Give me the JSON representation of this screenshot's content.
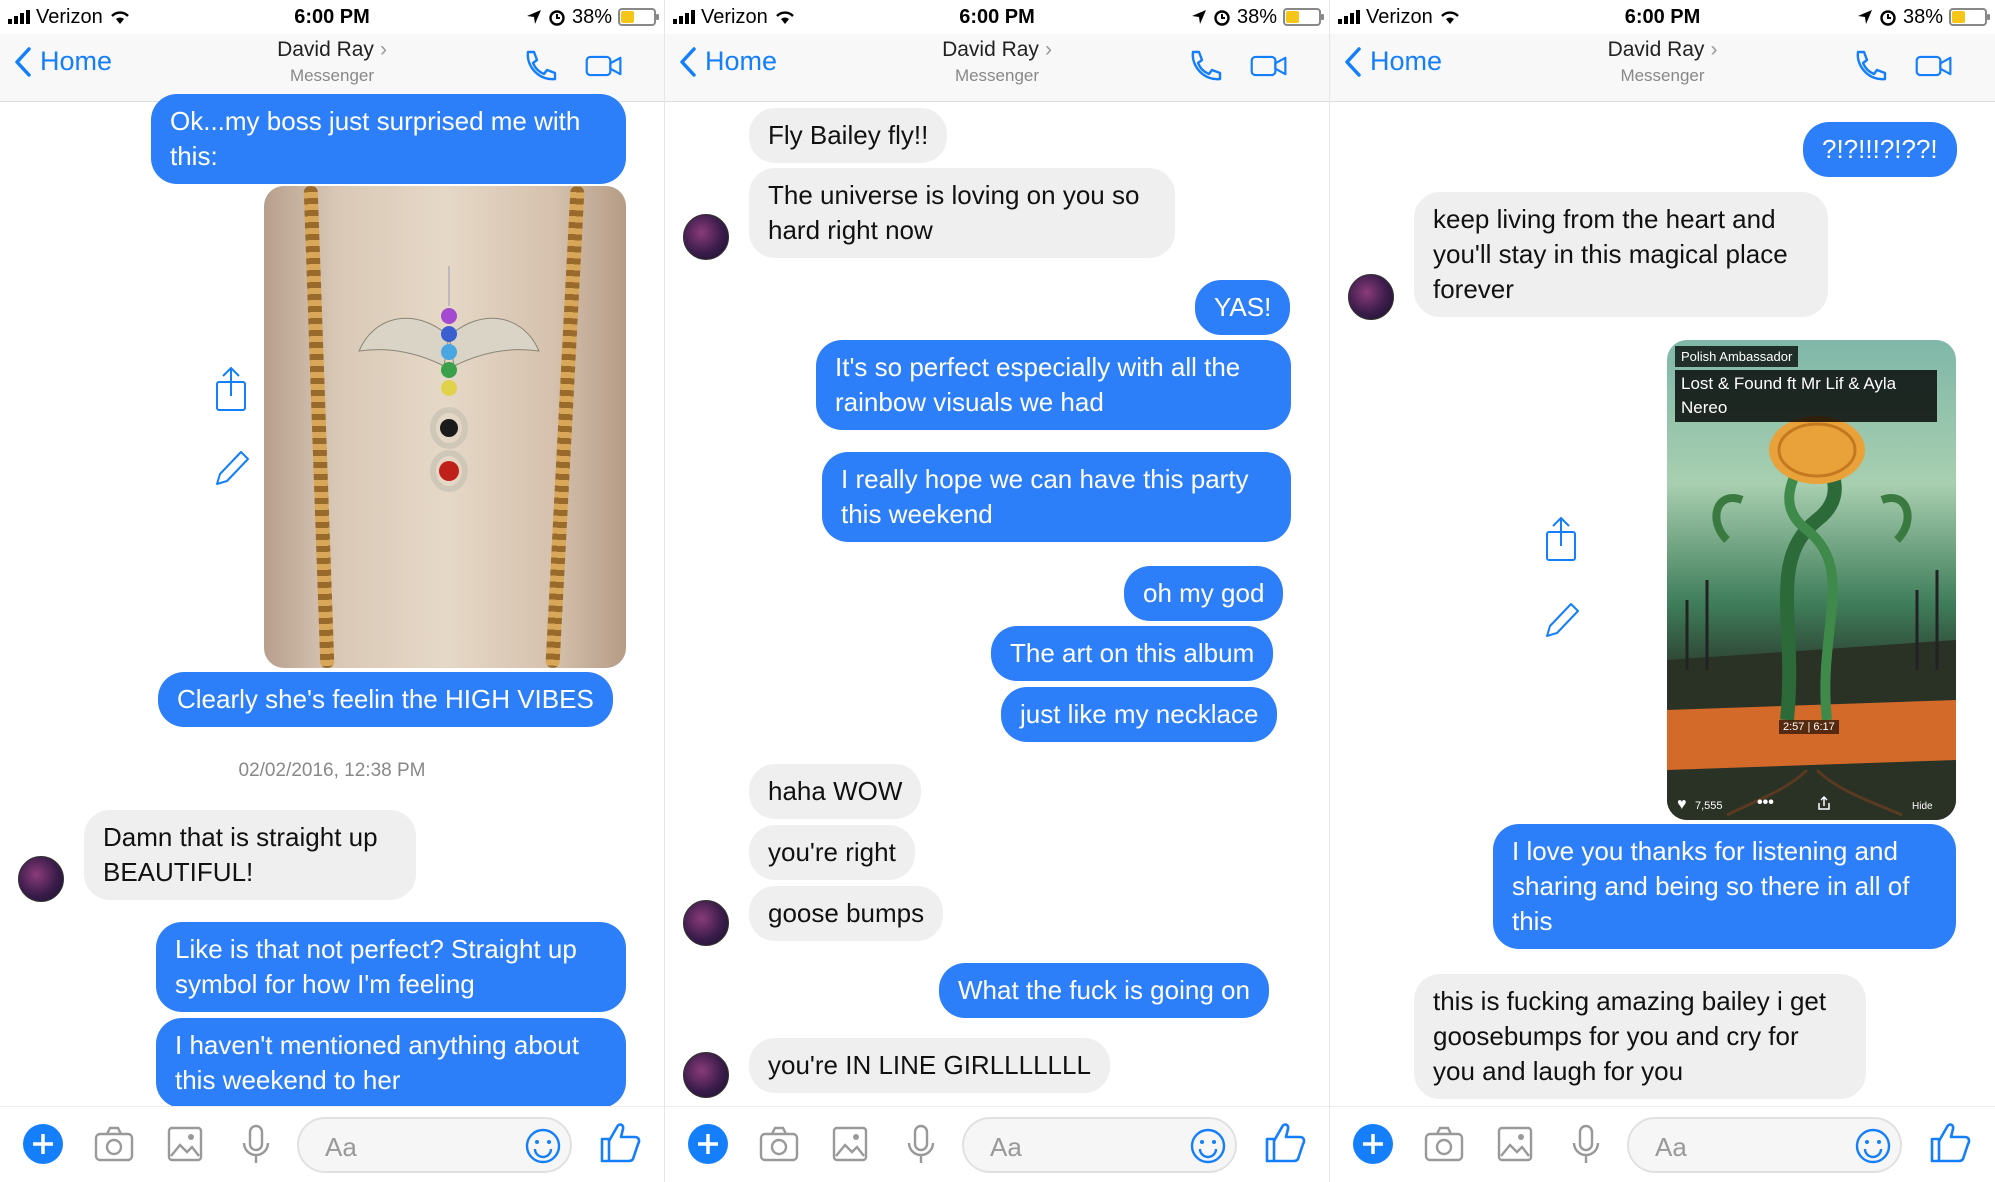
{
  "colors": {
    "accent": "#2d7ff9",
    "incoming": "#efefef",
    "nav_blue": "#147efb"
  },
  "status": {
    "carrier": "Verizon",
    "time": "6:00 PM",
    "battery": "38%",
    "battery_level": 0.38
  },
  "nav": {
    "back": "Home",
    "name": "David Ray",
    "sub": "Messenger"
  },
  "composer": {
    "placeholder": "Aa"
  },
  "screens": [
    {
      "messages": [
        {
          "text": "Ok...my boss just surprised me with this:"
        },
        {
          "text": "Clearly she's feelin the HIGH VIBES"
        },
        {
          "text": "02/02/2016, 12:38 PM"
        },
        {
          "text": "Damn that is straight up BEAUTIFUL!"
        },
        {
          "text": "Like is that not perfect? Straight up symbol for how I'm feeling"
        },
        {
          "text": "I haven't mentioned anything about this weekend to her"
        }
      ]
    },
    {
      "messages": [
        {
          "text": "Fly Bailey fly!!"
        },
        {
          "text": "The universe is loving on you so hard right now"
        },
        {
          "text": "YAS!"
        },
        {
          "text": "It's so perfect especially with all the rainbow visuals we had"
        },
        {
          "text": "I really hope we can have this party this weekend"
        },
        {
          "text": "oh my god"
        },
        {
          "text": "The art on this album"
        },
        {
          "text": "just like my necklace"
        },
        {
          "text": "haha WOW"
        },
        {
          "text": "you're right"
        },
        {
          "text": "goose bumps"
        },
        {
          "text": "What the fuck is going on"
        },
        {
          "text": "you're IN LINE GIRLLLLLLL"
        }
      ]
    },
    {
      "messages": [
        {
          "text": "?!?!!!?!??!"
        },
        {
          "text": "keep living from the heart and you'll stay in this magical place forever"
        },
        {
          "text": "I love you thanks for listening and sharing and being so there in all of this"
        },
        {
          "text": "this is fucking amazing bailey i get goosebumps for you and cry for you and laugh for you"
        }
      ],
      "album": {
        "channel": "Polish Ambassador",
        "track": "Lost & Found ft Mr Lif & Ayla Nereo",
        "time": "2:57 | 6:17",
        "likes": "7,555",
        "hide": "Hide"
      }
    }
  ]
}
